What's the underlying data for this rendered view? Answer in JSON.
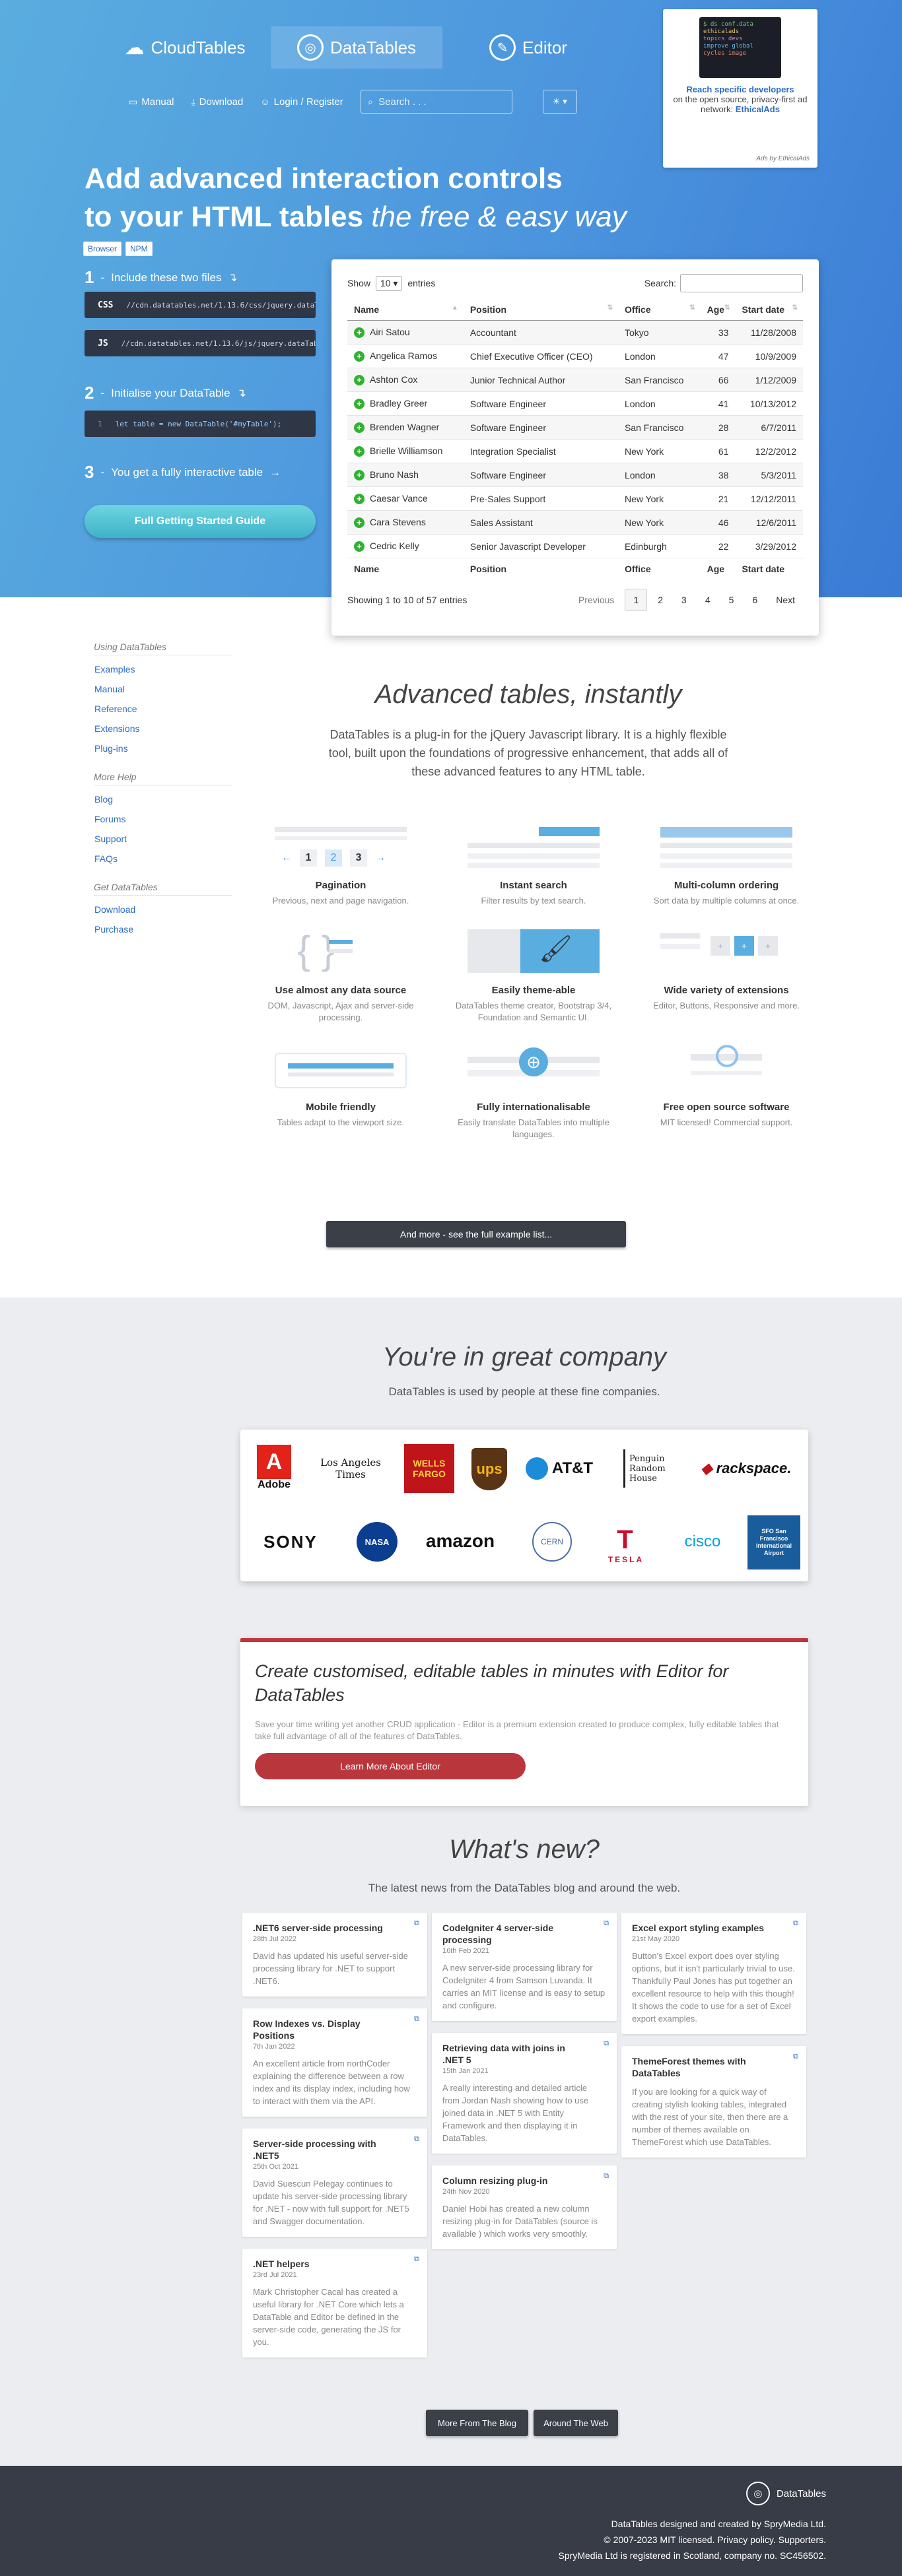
{
  "nav": {
    "brands": [
      {
        "label": "CloudTables",
        "icon": "cloud-icon"
      },
      {
        "label": "DataTables",
        "icon": "datatables-logo-icon"
      },
      {
        "label": "Editor",
        "icon": "editor-logo-icon"
      }
    ],
    "links": [
      {
        "label": "Manual",
        "icon": "book-icon"
      },
      {
        "label": "Download",
        "icon": "download-icon"
      },
      {
        "label": "Login / Register",
        "icon": "user-icon"
      }
    ],
    "search_placeholder": "Search . . ."
  },
  "ad": {
    "code_lines": [
      "$ ds conf.data",
      "ethicalads",
      "topics devs",
      "improve global",
      "cycles image"
    ],
    "title": "Reach specific developers",
    "text": "on the open source, privacy-first ad network:",
    "link": "EthicalAds",
    "footer": "Ads by EthicalAds"
  },
  "hero": {
    "line1": "Add advanced interaction controls",
    "line2": "to your HTML tables",
    "line2_em": "the free & easy way",
    "tabs": [
      "Browser",
      "NPM"
    ],
    "step1": "Include these two files",
    "css_label": "CSS",
    "css_url": "//cdn.datatables.net/1.13.6/css/jquery.dataTables.min.css",
    "js_label": "JS",
    "js_url": "//cdn.datatables.net/1.13.6/js/jquery.dataTables.min.js",
    "step2": "Initialise your DataTable",
    "code_line": "let table = new DataTable('#myTable');",
    "code_num": "1",
    "step3": "You get a fully interactive table",
    "cta": "Full Getting Started Guide",
    "nums": [
      "1",
      "2",
      "3"
    ]
  },
  "table": {
    "show": "Show",
    "entries_val": "10",
    "entries": "entries",
    "search": "Search:",
    "columns": [
      "Name",
      "Position",
      "Office",
      "Age",
      "Start date"
    ],
    "rows": [
      [
        "Airi Satou",
        "Accountant",
        "Tokyo",
        "33",
        "11/28/2008"
      ],
      [
        "Angelica Ramos",
        "Chief Executive Officer (CEO)",
        "London",
        "47",
        "10/9/2009"
      ],
      [
        "Ashton Cox",
        "Junior Technical Author",
        "San Francisco",
        "66",
        "1/12/2009"
      ],
      [
        "Bradley Greer",
        "Software Engineer",
        "London",
        "41",
        "10/13/2012"
      ],
      [
        "Brenden Wagner",
        "Software Engineer",
        "San Francisco",
        "28",
        "6/7/2011"
      ],
      [
        "Brielle Williamson",
        "Integration Specialist",
        "New York",
        "61",
        "12/2/2012"
      ],
      [
        "Bruno Nash",
        "Software Engineer",
        "London",
        "38",
        "5/3/2011"
      ],
      [
        "Caesar Vance",
        "Pre-Sales Support",
        "New York",
        "21",
        "12/12/2011"
      ],
      [
        "Cara Stevens",
        "Sales Assistant",
        "New York",
        "46",
        "12/6/2011"
      ],
      [
        "Cedric Kelly",
        "Senior Javascript Developer",
        "Edinburgh",
        "22",
        "3/29/2012"
      ]
    ],
    "info": "Showing 1 to 10 of 57 entries",
    "previous": "Previous",
    "pages": [
      "1",
      "2",
      "3",
      "4",
      "5",
      "6"
    ],
    "next": "Next"
  },
  "sidebar": {
    "groups": [
      {
        "heading": "Using DataTables",
        "links": [
          "Examples",
          "Manual",
          "Reference",
          "Extensions",
          "Plug-ins"
        ]
      },
      {
        "heading": "More Help",
        "links": [
          "Blog",
          "Forums",
          "Support",
          "FAQs"
        ]
      },
      {
        "heading": "Get DataTables",
        "links": [
          "Download",
          "Purchase"
        ]
      }
    ]
  },
  "features_section": {
    "title": "Advanced tables, instantly",
    "intro": "DataTables is a plug-in for the jQuery Javascript library. It is a highly flexible tool, built upon the foundations of progressive enhancement, that adds all of these advanced features to any HTML table.",
    "items": [
      {
        "title": "Pagination",
        "text": "Previous, next and page navigation."
      },
      {
        "title": "Instant search",
        "text": "Filter results by text search."
      },
      {
        "title": "Multi-column ordering",
        "text": "Sort data by multiple columns at once."
      },
      {
        "title": "Use almost any data source",
        "text": "DOM, Javascript, Ajax and server-side processing."
      },
      {
        "title": "Easily theme-able",
        "text": "DataTables theme creator, Bootstrap 3/4, Foundation and Semantic UI."
      },
      {
        "title": "Wide variety of extensions",
        "text": "Editor, Buttons, Responsive and more."
      },
      {
        "title": "Mobile friendly",
        "text": "Tables adapt to the viewport size."
      },
      {
        "title": "Fully internationalisable",
        "text": "Easily translate DataTables into multiple languages."
      },
      {
        "title": "Free open source software",
        "text": "MIT licensed! Commercial support."
      }
    ],
    "pager_pic": [
      "1",
      "2",
      "3"
    ],
    "more_button": "And more - see the full example list..."
  },
  "company": {
    "title": "You're in great company",
    "subtitle": "DataTables is used by people at these fine companies.",
    "logos": [
      "Adobe",
      "Los Angeles Times",
      "WELLS FARGO",
      "ups",
      "AT&T",
      "Penguin Random House",
      "rackspace.",
      "SONY",
      "NASA",
      "amazon",
      "CERN",
      "TESLA",
      "cisco",
      "SFO San Francisco International Airport"
    ]
  },
  "editor_promo": {
    "title": "Create customised, editable tables in minutes with Editor for DataTables",
    "text": "Save your time writing yet another CRUD application - Editor is a premium extension created to produce complex, fully editable tables that take full advantage of all of the features of DataTables.",
    "button": "Learn More About Editor"
  },
  "news": {
    "title": "What's new?",
    "subtitle": "The latest news from the DataTables blog and around the web.",
    "columns": [
      [
        {
          "title": ".NET6 server-side processing",
          "date": "28th Jul 2022",
          "text": "David has updated his useful server-side processing library for .NET to support .NET6."
        },
        {
          "title": "Row Indexes vs. Display Positions",
          "date": "7th Jan 2022",
          "text": "An excellent article from northCoder explaining the difference between a row index and its display index, including how to interact with them via the API."
        },
        {
          "title": "Server-side processing with .NET5",
          "date": "25th Oct 2021",
          "text": "David Suescun Pelegay continues to update his server-side processing library for .NET - now with full support for .NET5 and Swagger documentation."
        },
        {
          "title": ".NET helpers",
          "date": "23rd Jul 2021",
          "text": "Mark Christopher Cacal has created a useful library for .NET Core which lets a DataTable and Editor be defined in the server-side code, generating the JS for you."
        }
      ],
      [
        {
          "title": "CodeIgniter 4 server-side processing",
          "date": "16th Feb 2021",
          "text": "A new server-side processing library for CodeIgniter 4 from Samson Luvanda. It carries an MIT license and is easy to setup and configure."
        },
        {
          "title": "Retrieving data with joins in .NET 5",
          "date": "15th Jan 2021",
          "text": "A really interesting and detailed article from Jordan Nash showing how to use joined data in .NET 5 with Entity Framework and then displaying it in DataTables."
        },
        {
          "title": "Column resizing plug-in",
          "date": "24th Nov 2020",
          "text": "Daniel Hobi has created a new column resizing plug-in for DataTables (source is available ) which works very smoothly."
        }
      ],
      [
        {
          "title": "Excel export styling examples",
          "date": "21st May 2020",
          "text": "Button's Excel export does over styling options, but it isn't particularly trivial to use. Thankfully Paul Jones has put together an excellent resource to help with this though! It shows the code to use for a set of Excel export examples."
        },
        {
          "title": "ThemeForest themes with DataTables",
          "date": "",
          "text": "If you are looking for a quick way of creating stylish looking tables, integrated with the rest of your site, then there are a number of themes available on ThemeForest which use DataTables."
        }
      ]
    ],
    "more_blog": "More From The Blog",
    "around_web": "Around The Web"
  },
  "footer": {
    "brand": "DataTables",
    "line1": "DataTables designed and created by SpryMedia Ltd.",
    "line2": "© 2007-2023 MIT licensed. Privacy policy. Supporters.",
    "line3": "SpryMedia Ltd is registered in Scotland, company no. SC456502."
  },
  "colors": {
    "hero_start": "#5aaddf",
    "hero_end": "#3a7bd5",
    "accent": "#2b6cc4",
    "editor_red": "#c0353f",
    "footer_bg": "#383c46"
  }
}
